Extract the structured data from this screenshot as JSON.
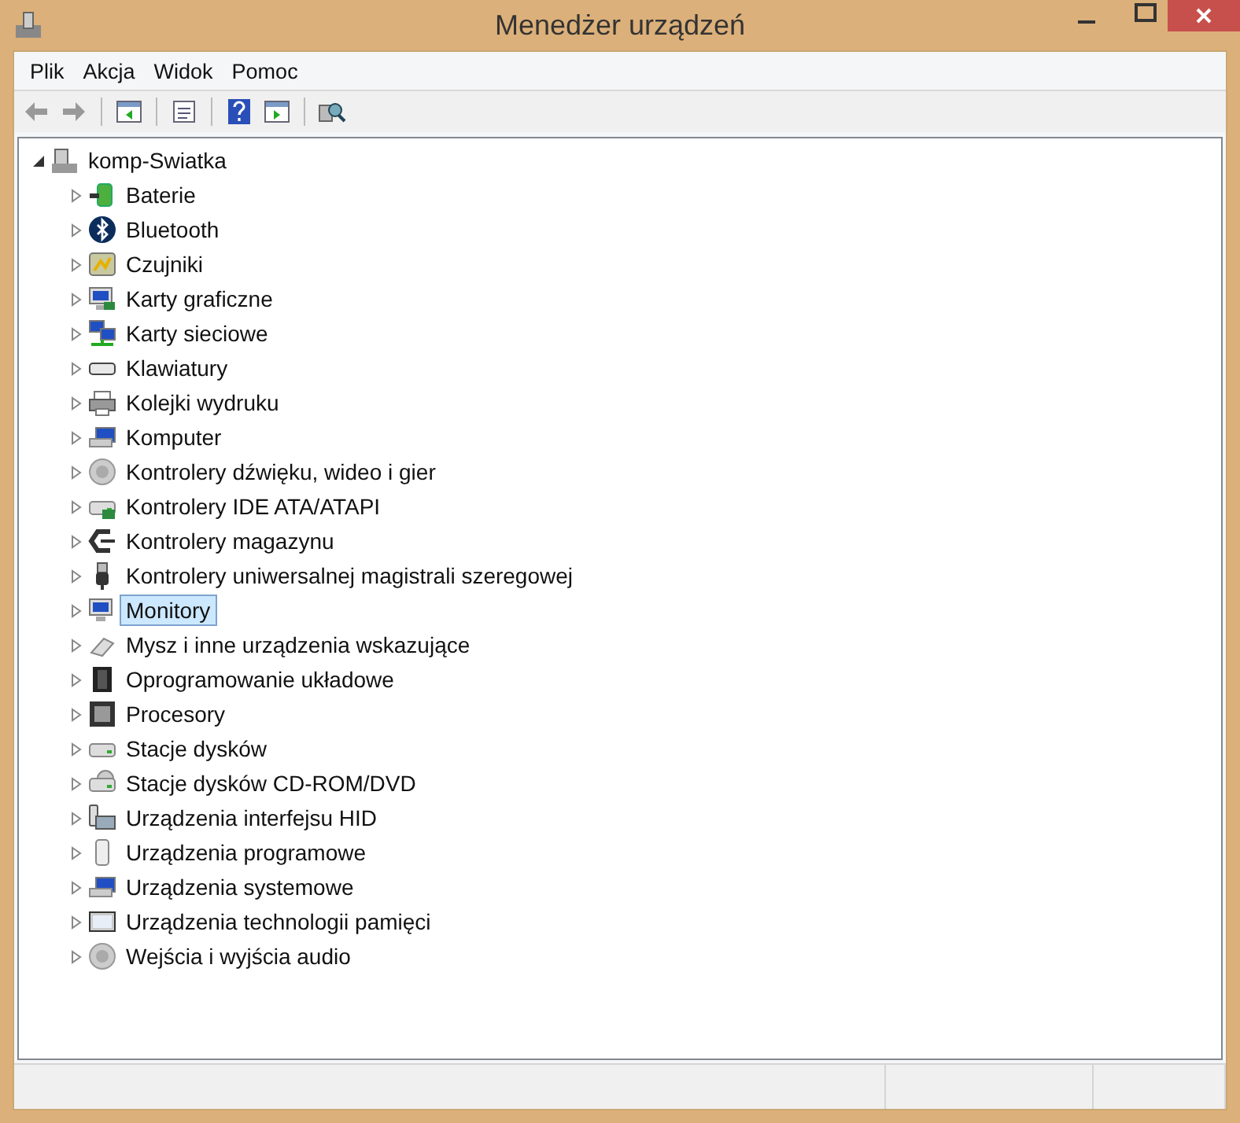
{
  "window": {
    "title": "Menedżer urządzeń"
  },
  "menu": [
    "Plik",
    "Akcja",
    "Widok",
    "Pomoc"
  ],
  "tree": {
    "label": "komp-Swiatka",
    "expanded": true,
    "children": [
      {
        "label": "Baterie",
        "expanded": false,
        "selected": false
      },
      {
        "label": "Bluetooth",
        "expanded": false,
        "selected": false
      },
      {
        "label": "Czujniki",
        "expanded": false,
        "selected": false
      },
      {
        "label": "Karty graficzne",
        "expanded": false,
        "selected": false
      },
      {
        "label": "Karty sieciowe",
        "expanded": false,
        "selected": false
      },
      {
        "label": "Klawiatury",
        "expanded": false,
        "selected": false
      },
      {
        "label": "Kolejki wydruku",
        "expanded": false,
        "selected": false
      },
      {
        "label": "Komputer",
        "expanded": false,
        "selected": false
      },
      {
        "label": "Kontrolery dźwięku, wideo i gier",
        "expanded": false,
        "selected": false
      },
      {
        "label": "Kontrolery IDE ATA/ATAPI",
        "expanded": false,
        "selected": false
      },
      {
        "label": "Kontrolery magazynu",
        "expanded": false,
        "selected": false
      },
      {
        "label": "Kontrolery uniwersalnej magistrali szeregowej",
        "expanded": false,
        "selected": false
      },
      {
        "label": "Monitory",
        "expanded": false,
        "selected": true
      },
      {
        "label": "Mysz i inne urządzenia wskazujące",
        "expanded": false,
        "selected": false
      },
      {
        "label": "Oprogramowanie układowe",
        "expanded": false,
        "selected": false
      },
      {
        "label": "Procesory",
        "expanded": false,
        "selected": false
      },
      {
        "label": "Stacje dysków",
        "expanded": false,
        "selected": false
      },
      {
        "label": "Stacje dysków CD-ROM/DVD",
        "expanded": false,
        "selected": false
      },
      {
        "label": "Urządzenia interfejsu HID",
        "expanded": false,
        "selected": false
      },
      {
        "label": "Urządzenia programowe",
        "expanded": false,
        "selected": false
      },
      {
        "label": "Urządzenia systemowe",
        "expanded": false,
        "selected": false
      },
      {
        "label": "Urządzenia technologii pamięci",
        "expanded": false,
        "selected": false
      },
      {
        "label": "Wejścia i wyjścia audio",
        "expanded": false,
        "selected": false
      }
    ]
  }
}
